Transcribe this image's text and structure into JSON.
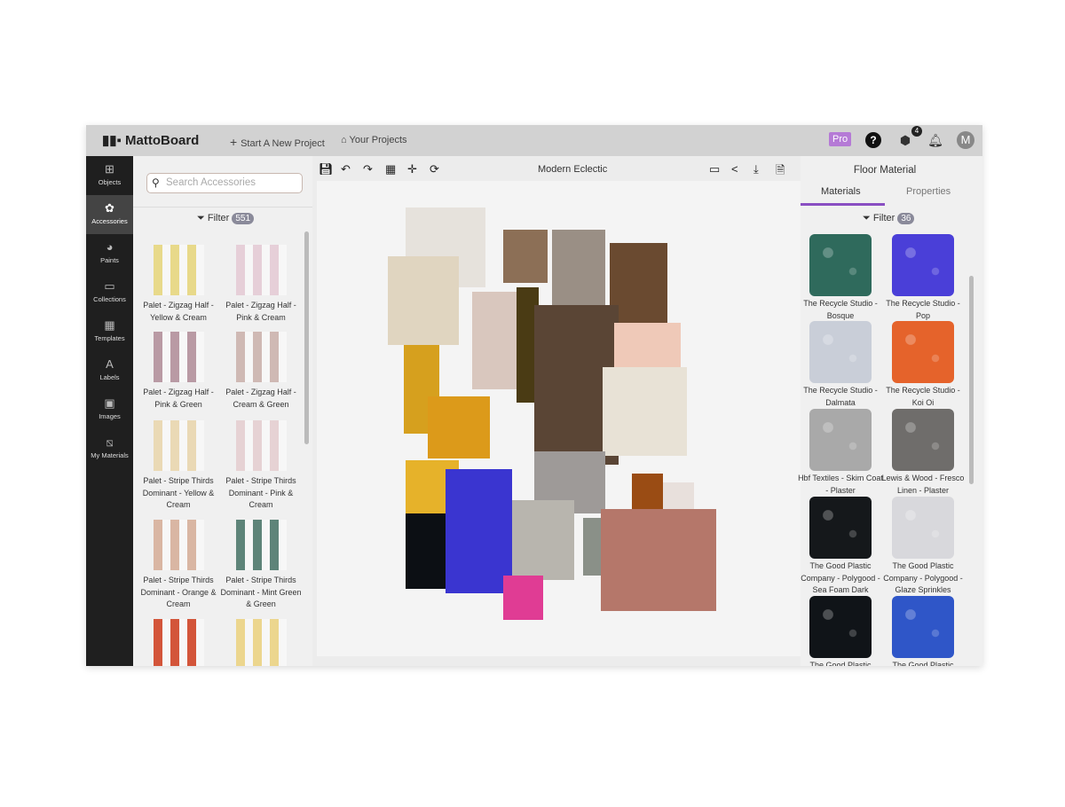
{
  "header": {
    "logo": "MattoBoard",
    "new_project": "Start A New Project",
    "your_projects": "Your Projects",
    "pro": "Pro",
    "cart_count": "4",
    "avatar": "M"
  },
  "sidebar": {
    "items": [
      {
        "label": "Objects",
        "icon": "objects-icon"
      },
      {
        "label": "Accessories",
        "icon": "accessories-icon",
        "active": true
      },
      {
        "label": "Paints",
        "icon": "palette-icon"
      },
      {
        "label": "Collections",
        "icon": "folder-icon"
      },
      {
        "label": "Templates",
        "icon": "templates-icon"
      },
      {
        "label": "Labels",
        "icon": "label-icon"
      },
      {
        "label": "Images",
        "icon": "image-icon"
      },
      {
        "label": "My Materials",
        "icon": "materials-icon"
      }
    ]
  },
  "accessories": {
    "search_placeholder": "Search Accessories",
    "filter": "Filter",
    "count": "551",
    "items": [
      {
        "label": "Palet - Zigzag Half - Yellow & Cream",
        "color": "#e8d98a"
      },
      {
        "label": "Palet - Zigzag Half - Pink & Cream",
        "color": "#e6cfd8"
      },
      {
        "label": "Palet - Zigzag Half - Pink & Green",
        "color": "#b99aa4"
      },
      {
        "label": "Palet - Zigzag Half - Cream & Green",
        "color": "#cfb9b4"
      },
      {
        "label": "Palet - Stripe Thirds Dominant - Yellow & Cream",
        "color": "#ead9b5"
      },
      {
        "label": "Palet - Stripe Thirds Dominant - Pink & Cream",
        "color": "#e6d2d4"
      },
      {
        "label": "Palet - Stripe Thirds Dominant - Orange & Cream",
        "color": "#d9b6a3"
      },
      {
        "label": "Palet - Stripe Thirds Dominant - Mint Green & Green",
        "color": "#5e8479"
      },
      {
        "label": "",
        "color": "#d3553a"
      },
      {
        "label": "",
        "color": "#ecd68e"
      }
    ]
  },
  "toolbar": {
    "project_title": "Modern Eclectic"
  },
  "right_panel": {
    "title": "Floor Material",
    "tabs": [
      "Materials",
      "Properties"
    ],
    "filter": "Filter",
    "count": "36",
    "accent": "#8a4fc2",
    "items": [
      {
        "label": "The Recycle Studio - Bosque",
        "color": "#2f6a5c"
      },
      {
        "label": "The Recycle Studio - Pop",
        "color": "#4a3fd8"
      },
      {
        "label": "The Recycle Studio - Dalmata",
        "color": "#c9ced8"
      },
      {
        "label": "The Recycle Studio - Koi Oi",
        "color": "#e5632b"
      },
      {
        "label": "Hbf Textiles - Skim Coat - Plaster",
        "color": "#a9a9a9"
      },
      {
        "label": "Lewis & Wood - Fresco Linen - Plaster",
        "color": "#6f6d6b"
      },
      {
        "label": "The Good Plastic Company - Polygood - Sea  Foam Dark",
        "color": "#15181b"
      },
      {
        "label": "The Good Plastic Company - Polygood - Glaze Sprinkles",
        "color": "#d8d8dc"
      },
      {
        "label": "The Good Plastic",
        "color": "#101418"
      },
      {
        "label": "The Good Plastic",
        "color": "#2f56c8"
      }
    ]
  }
}
